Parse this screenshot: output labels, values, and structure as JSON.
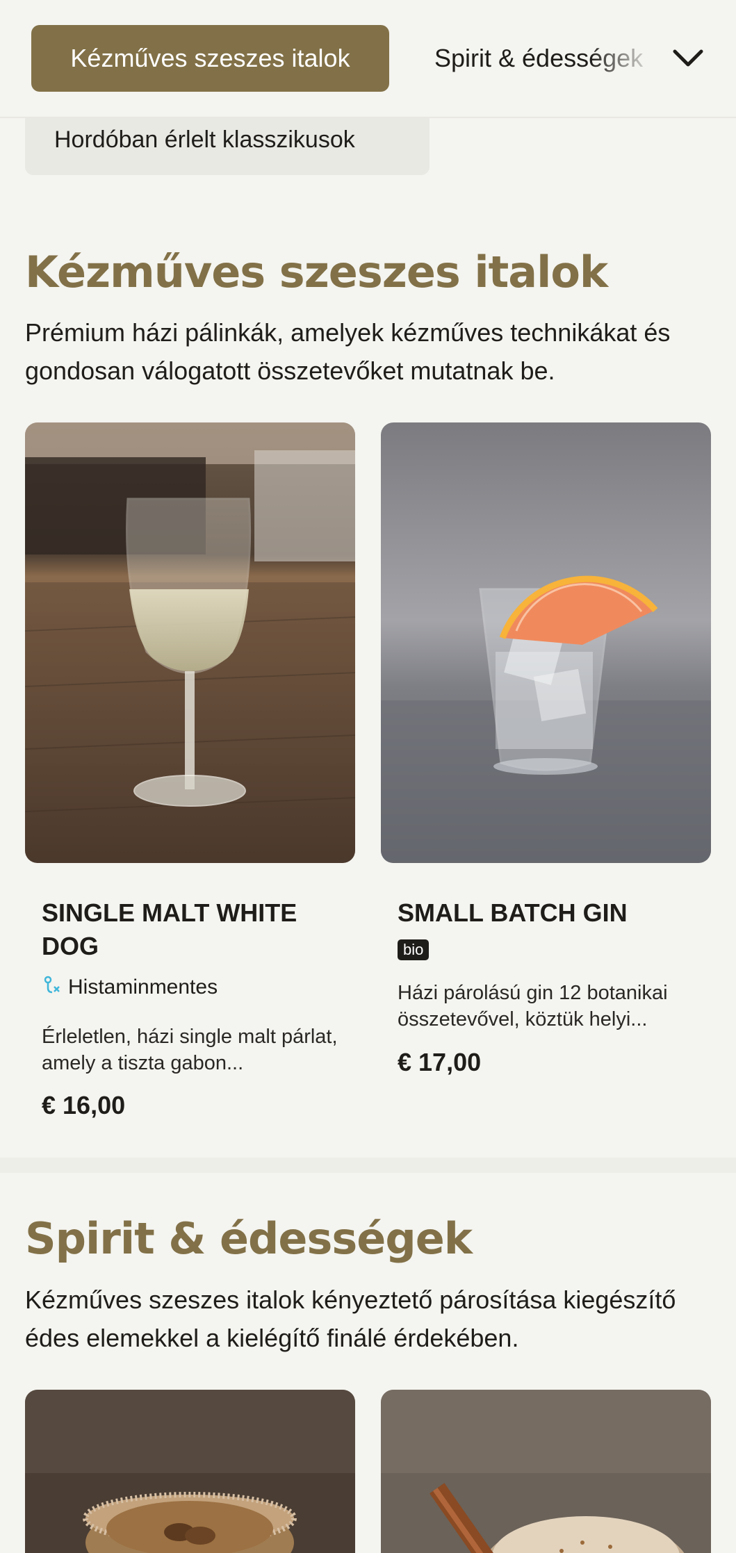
{
  "nav": {
    "active_tab": "Kézműves szeszes italok",
    "next_tab": "Spirit & édességek",
    "sub_tab": "Hordóban érlelt klasszikusok"
  },
  "sections": [
    {
      "title": "Kézműves szeszes italok",
      "description": "Prémium házi pálinkák, amelyek kézműves technikákat és gondosan válogatott összetevőket mutatnak be.",
      "items": [
        {
          "name": "SINGLE MALT WHITE DOG",
          "allergen": "Histaminmentes",
          "description": "Érleletlen, házi single malt párlat, amely a tiszta gabon...",
          "price": "€ 16,00"
        },
        {
          "name": "SMALL BATCH GIN",
          "badge": "bio",
          "description": "Házi párolású gin 12 botanikai összetevővel, köztük helyi...",
          "price": "€ 17,00"
        }
      ]
    },
    {
      "title": "Spirit & édességek",
      "description": "Kézműves szeszes italok kényeztető párosítása kiegészítő édes elemekkel a kielégítő finálé érdekében."
    }
  ],
  "colors": {
    "accent": "#827148",
    "background": "#f4f4f0",
    "text": "#1f1d1a",
    "allergen_icon": "#3fb6d9"
  }
}
